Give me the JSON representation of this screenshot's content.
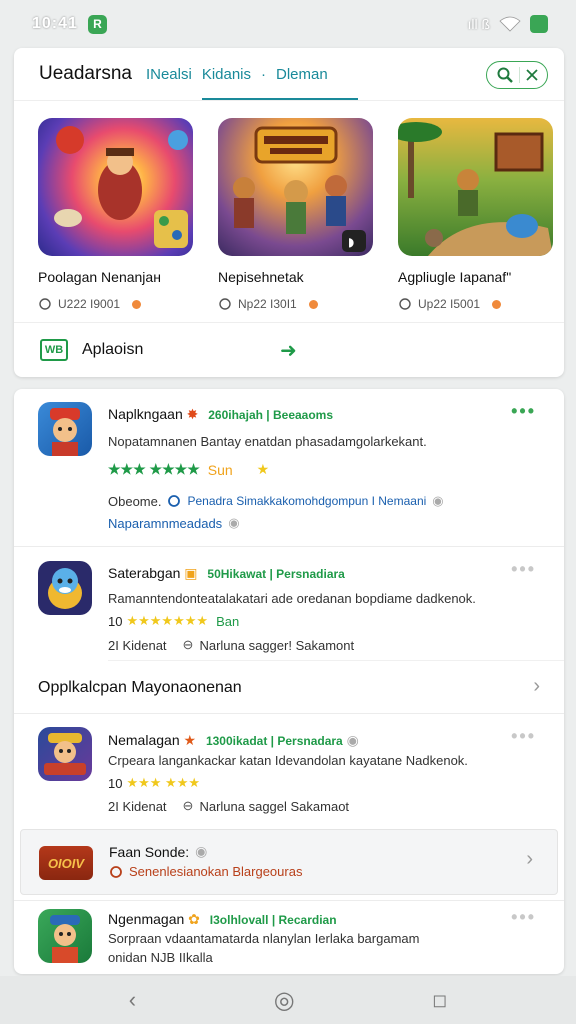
{
  "status": {
    "time": "10:41",
    "app_badge": "R",
    "signal": "ıll ß"
  },
  "header": {
    "title": "Ueadarsna",
    "tabs": [
      "INealsi",
      "Kidanis",
      "Dleman"
    ],
    "tab_separator": "·"
  },
  "featured": [
    {
      "title": "Poolagan Nenanjaн",
      "meta": "U222 I9001"
    },
    {
      "title": "Nepisehnetak",
      "meta": "Np22 I30I1"
    },
    {
      "title": "Agpliugle Iapanaf\"",
      "meta": "Up22 I5001"
    }
  ],
  "apps_row": {
    "logo": "WB",
    "label": "Aplaoisn",
    "arrow": "➜"
  },
  "list": {
    "items": [
      {
        "title": "Naplkngaan",
        "tag": "260ihajah | Beeaaoms",
        "desc": "Nopatamnanen Bantay enatdan phasadamgolarkekant.",
        "stars": "★★★ ★★★★",
        "stars_suffix": "Sun",
        "extra_star": "★",
        "line1_a": "Obeome.",
        "line1_b": "Penadra Simakkakomohdgompun I Nemaani",
        "line2": "Naparamnmeadads"
      },
      {
        "title": "Saterabgan",
        "tag": "50Hikawat | Persnadiara",
        "desc": "Ramanntendonteatalakatari ade oredanan bopdiame dadkenok.",
        "stars_prefix": "10",
        "stars": "★★★★★★★",
        "stars_suffix": "Ban",
        "sub_a": "2I Kidenat",
        "sub_b": "Narluna sagger! Sakamont"
      },
      {
        "title": "Nemalagan",
        "tag": "1300ikadat | Persnadara",
        "desc": "Crpeara langankackar katan Idevandolan kayatane Nadkenok.",
        "stars_prefix": "10",
        "stars": "★★★ ★★★",
        "sub_a": "2I Kidenat",
        "sub_b": "Narluna saggel Sakamaot"
      },
      {
        "title": "Ngenmagan",
        "tag": "I3olhlovall | Recardian",
        "desc": "Sorpraan vdaantamatarda nlanylan Ierlaka bargamam",
        "desc2": "onidan NJB IIkalla"
      }
    ],
    "section_title": "Opplkalcpan Mayonaonenan",
    "chevron": "›",
    "promo": {
      "logo": "OIOIV",
      "title": "Faan Sonde:",
      "subtitle": "Senenlesianokan Blargeouras"
    },
    "more_glyph": "•••"
  },
  "nav": {
    "back": "‹",
    "home": "◎",
    "recent": "◻"
  },
  "colors": {
    "accent": "#1a8a9a",
    "green": "#3aa655",
    "star": "#f0a31c"
  }
}
